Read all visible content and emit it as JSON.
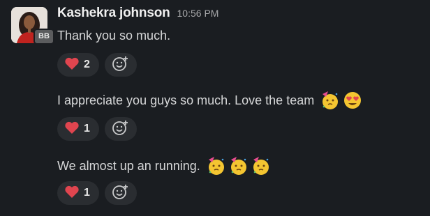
{
  "message": {
    "sender": "Kashekra johnson",
    "time": "10:56 PM",
    "badge": "BB",
    "items": [
      {
        "text": "Thank you so much.",
        "emojis": [],
        "reaction": {
          "icon": "red-heart-icon",
          "count": "2"
        }
      },
      {
        "text": "I appreciate you guys so much. Love the team",
        "emojis": [
          "partying-face-icon",
          "heart-eyes-face-icon"
        ],
        "reaction": {
          "icon": "red-heart-icon",
          "count": "1"
        }
      },
      {
        "text": "We almost up an running.",
        "emojis": [
          "partying-face-icon",
          "partying-face-icon",
          "partying-face-icon"
        ],
        "reaction": {
          "icon": "red-heart-icon",
          "count": "1"
        }
      }
    ]
  },
  "colors": {
    "background": "#1a1d21",
    "pill": "#2a2d31",
    "heart": "#e0454f"
  }
}
